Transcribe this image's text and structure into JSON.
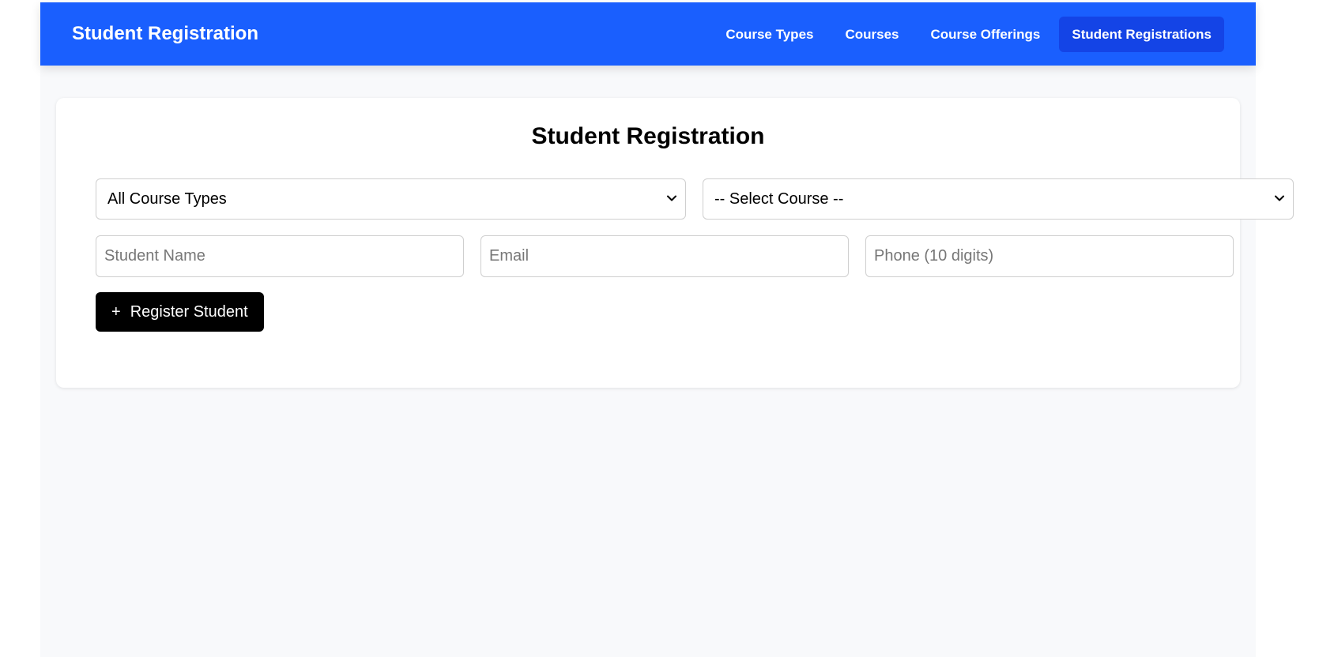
{
  "navbar": {
    "brand": "Student Registration",
    "items": [
      {
        "label": "Course Types",
        "active": false
      },
      {
        "label": "Courses",
        "active": false
      },
      {
        "label": "Course Offerings",
        "active": false
      },
      {
        "label": "Student Registrations",
        "active": true
      }
    ]
  },
  "form": {
    "title": "Student Registration",
    "course_type_select": {
      "selected": "All Course Types"
    },
    "course_select": {
      "selected": "-- Select Course --"
    },
    "student_name": {
      "placeholder": "Student Name",
      "value": ""
    },
    "email": {
      "placeholder": "Email",
      "value": ""
    },
    "phone": {
      "placeholder": "Phone (10 digits)",
      "value": ""
    },
    "register_button": {
      "icon": "plus-icon",
      "label": "Register Student"
    }
  },
  "colors": {
    "navbar_bg": "#1a5ffe",
    "nav_active_bg": "#1444e6",
    "page_bg": "#f8f9fb",
    "button_bg": "#000000"
  }
}
